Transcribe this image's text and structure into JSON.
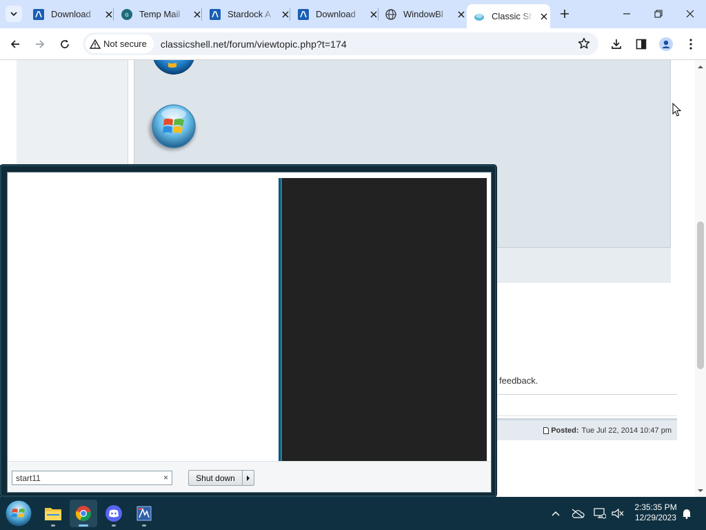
{
  "browser": {
    "tabs": [
      {
        "title": "Download",
        "favicon": "stardock-icon"
      },
      {
        "title": "Temp Mail",
        "favicon": "tempmail-icon"
      },
      {
        "title": "Stardock A",
        "favicon": "stardock-icon"
      },
      {
        "title": "Download",
        "favicon": "stardock-icon"
      },
      {
        "title": "WindowBl",
        "favicon": "globe-icon"
      },
      {
        "title": "Classic She",
        "favicon": "classicshell-icon",
        "active": true
      }
    ],
    "security_label": "Not secure",
    "url": "classicshell.net/forum/viewtopic.php?t=174"
  },
  "page": {
    "feedback_text": "feedback.",
    "posted_label": "Posted:",
    "posted_date": "Tue Jul 22, 2014 10:47 pm"
  },
  "start_menu": {
    "search_value": "start11",
    "search_clear": "×",
    "shutdown_label": "Shut down"
  },
  "taskbar": {
    "apps": [
      "file-explorer-icon",
      "chrome-icon",
      "discord-icon",
      "app-icon"
    ],
    "time": "2:35:35 PM",
    "date": "12/29/2023"
  },
  "colors": {
    "tab_strip": "#d3e3fd",
    "taskbar": "#0f3040",
    "start_menu_frame": "#102a38",
    "start_menu_right_pane": "#222222"
  }
}
